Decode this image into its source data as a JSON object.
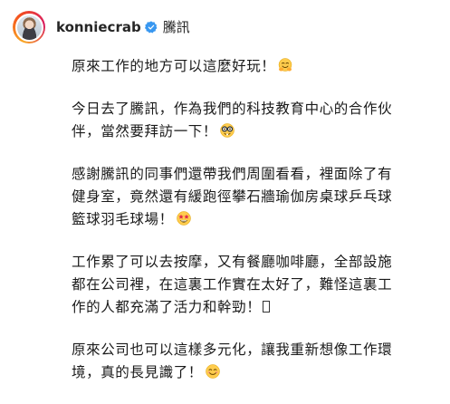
{
  "post": {
    "username": "konniecrab",
    "location": "騰訊",
    "verified": true,
    "accent_color": "#3897f0",
    "paragraphs": [
      {
        "lines": [
          {
            "text": "原來工作的地方可以這麼好玩！",
            "emoji": "hugging-face-emoji"
          }
        ]
      },
      {
        "lines": [
          {
            "text": "今日去了騰訊，作為我們的科技教育中心的合作伙",
            "emoji": ""
          },
          {
            "text": "伴，當然要拜訪一下！",
            "emoji": "nerd-face-emoji"
          }
        ]
      },
      {
        "lines": [
          {
            "text": "感謝騰訊的同事們還帶我們周圍看看，裡面除了有",
            "emoji": ""
          },
          {
            "text": "健身室，竟然還有緩跑徑攀石牆瑜伽房桌球乒乓球",
            "emoji": ""
          },
          {
            "text": "籃球羽毛球場！",
            "emoji": "star-struck-emoji"
          }
        ]
      },
      {
        "lines": [
          {
            "text": "工作累了可以去按摩，又有餐廳咖啡廳，全部設施",
            "emoji": ""
          },
          {
            "text": "都在公司裡，在這裏工作實在太好了，難怪這裏工",
            "emoji": ""
          },
          {
            "text": "作的人都充滿了活力和幹勁！",
            "emoji": "missing-glyph"
          }
        ]
      },
      {
        "lines": [
          {
            "text": "原來公司也可以這樣多元化，讓我重新想像工作環",
            "emoji": ""
          },
          {
            "text": "境，真的長見識了！",
            "emoji": "smiling-face-emoji"
          }
        ]
      }
    ]
  }
}
